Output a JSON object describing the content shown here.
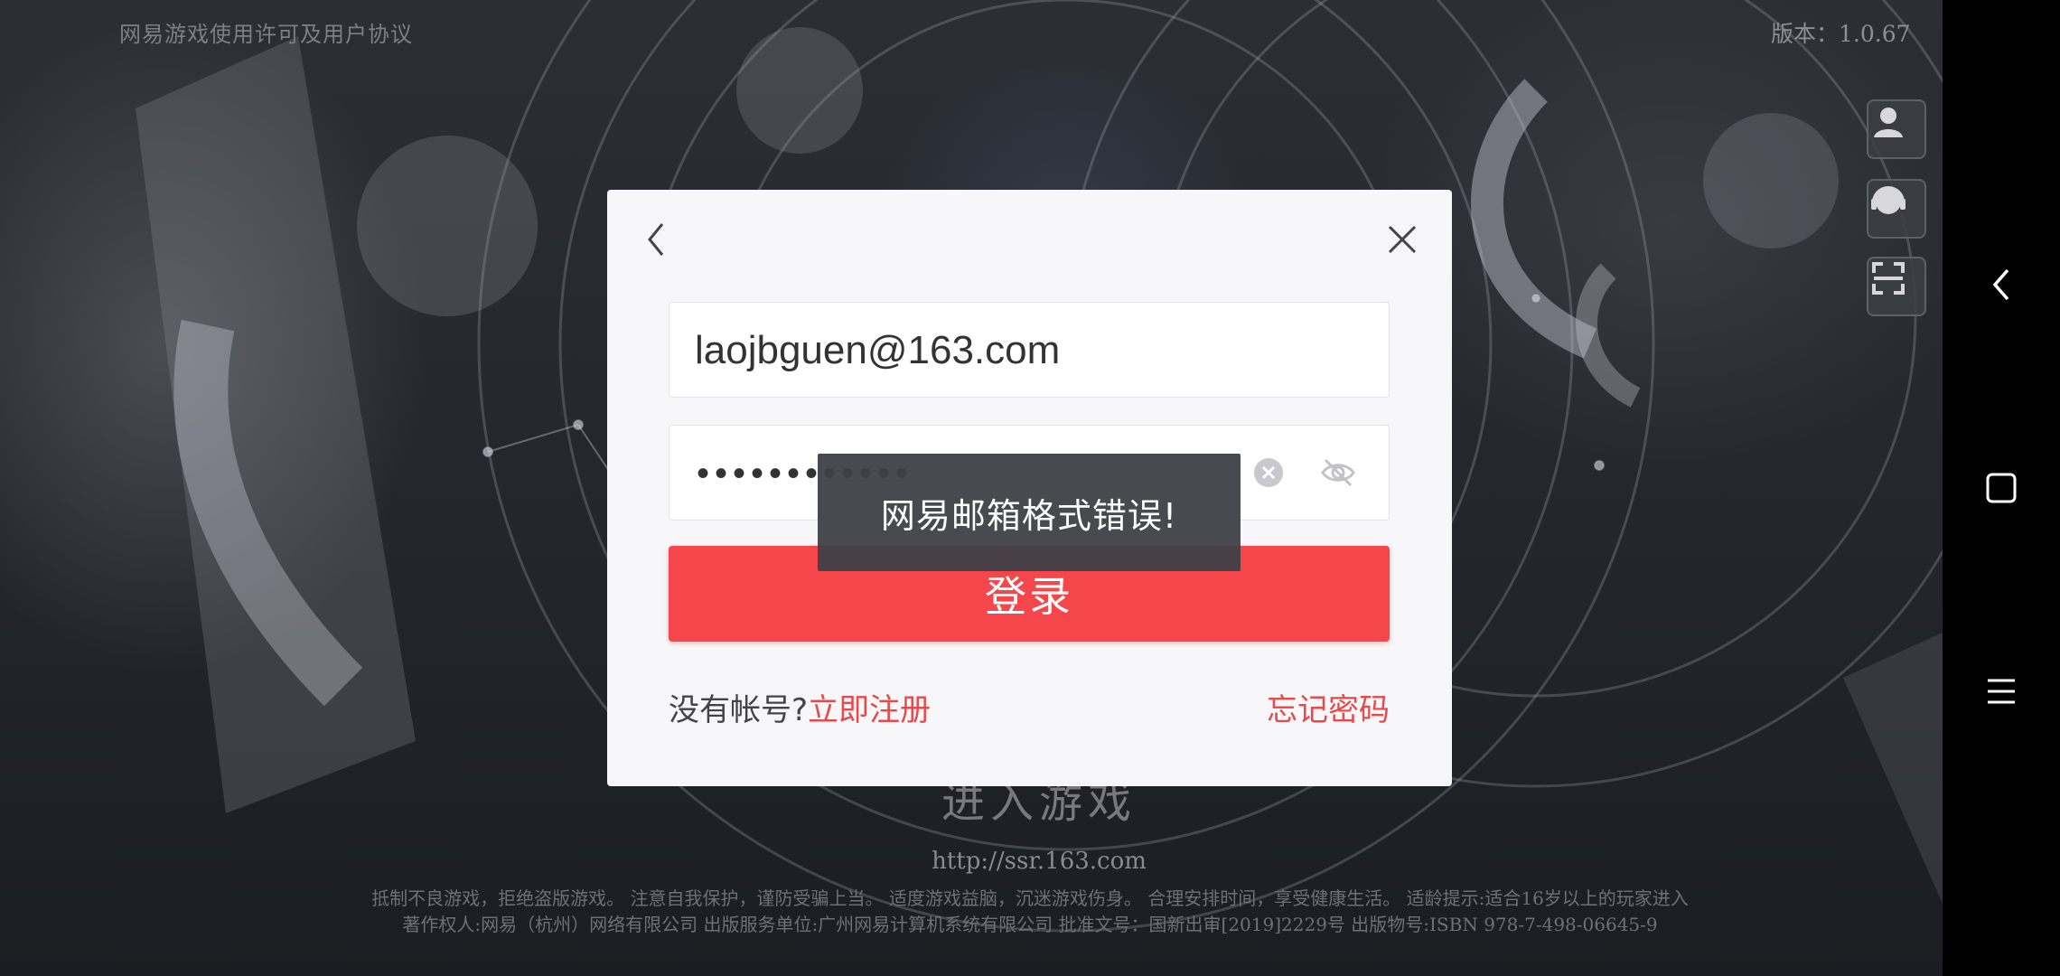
{
  "background": {
    "license_link": "网易游戏使用许可及用户协议",
    "version": "版本：1.0.67",
    "enter_game": "进入游戏",
    "site_url": "http://ssr.163.com",
    "notice_line1": "抵制不良游戏，拒绝盗版游戏。 注意自我保护，谨防受骗上当。 适度游戏益脑，沉迷游戏伤身。 合理安排时间，享受健康生活。  适龄提示:适合16岁以上的玩家进入",
    "notice_line2": "著作权人:网易（杭州）网络有限公司    出版服务单位:广州网易计算机系统有限公司    批准文号：国新出审[2019]2229号    出版物号:ISBN 978-7-498-06645-9",
    "side_buttons": [
      "avatar-icon",
      "headset-icon",
      "scan-icon"
    ]
  },
  "navbar": {
    "buttons": [
      "back-icon",
      "home-square-icon",
      "menu-icon"
    ]
  },
  "dialog": {
    "back_icon": "chevron-left-icon",
    "close_icon": "close-icon",
    "email_value": "laojbguen@163.com",
    "password_value": "••••••••••••",
    "login_label": "登录",
    "no_account_label": "没有帐号?",
    "register_label": "立即注册",
    "forgot_label": "忘记密码"
  },
  "toast": {
    "message": "网易邮箱格式错误!"
  },
  "colors": {
    "accent": "#f5474b",
    "link": "#e84a4c",
    "dialog_bg": "#f7f7f9",
    "toast_bg": "#3e4046"
  }
}
